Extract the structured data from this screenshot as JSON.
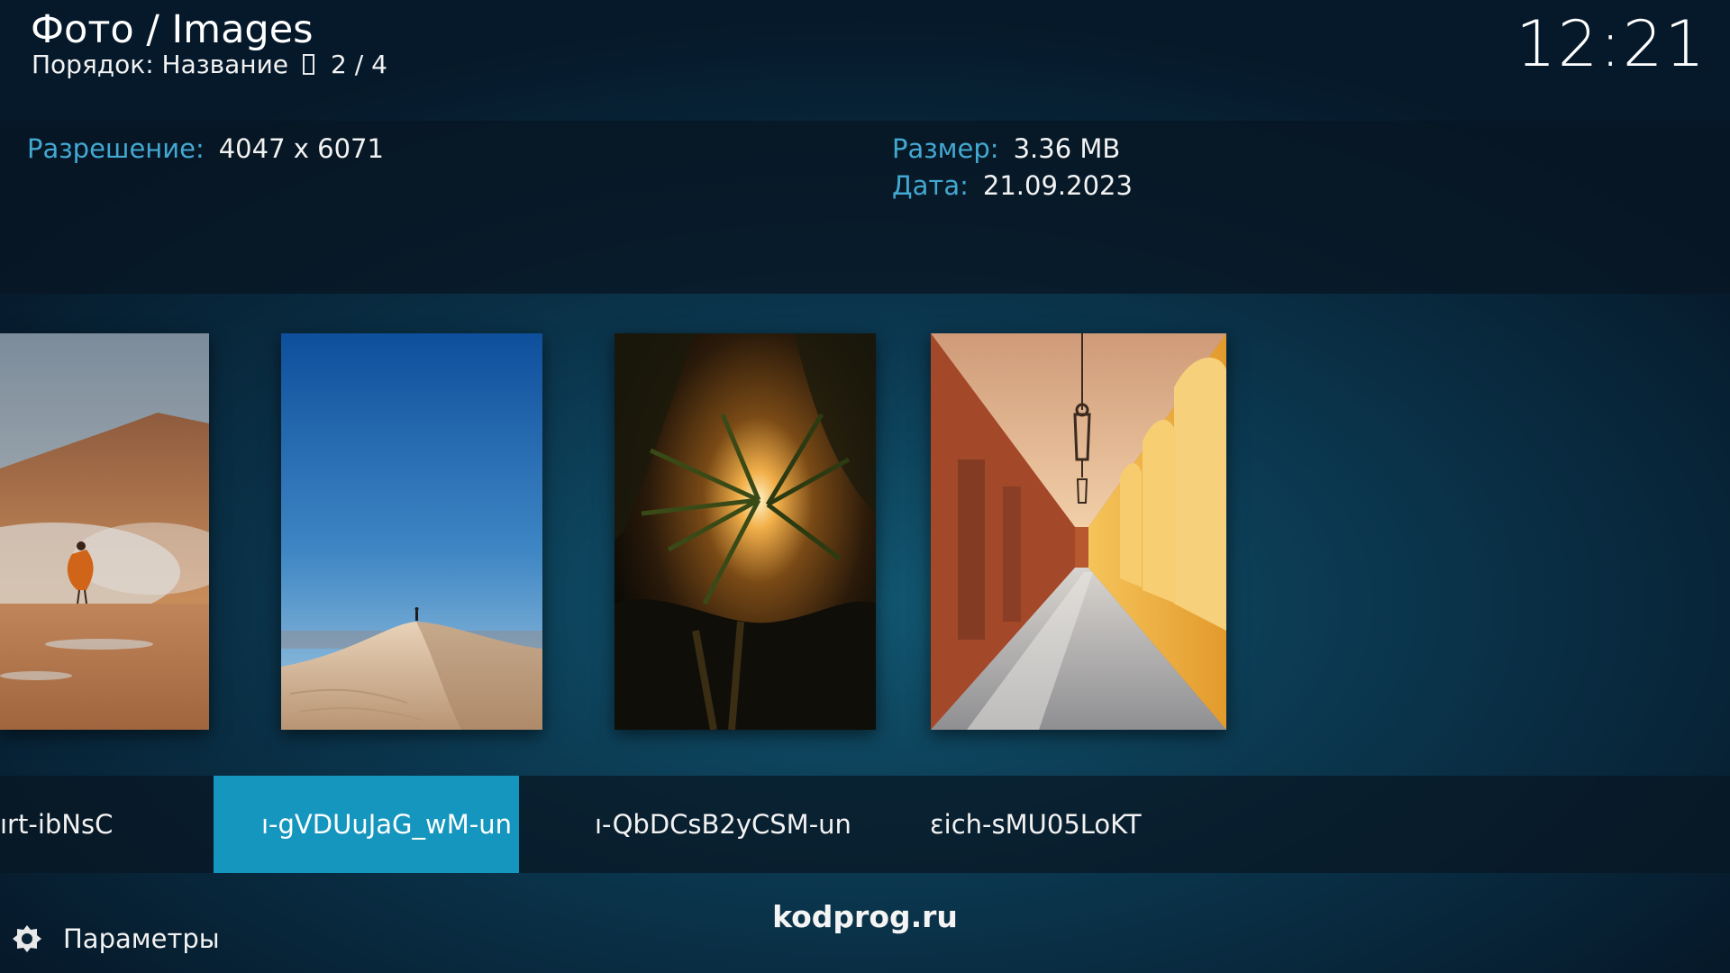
{
  "header": {
    "title": "Фото / Images",
    "sort_label": "Порядок: Название",
    "position": "2 / 4",
    "clock": "12:21"
  },
  "info": {
    "resolution_label": "Разрешение:",
    "resolution_value": "4047 x 6071",
    "size_label": "Размер:",
    "size_value": "3.36 MB",
    "date_label": "Дата:",
    "date_value": "21.09.2023"
  },
  "thumbnails": [
    {
      "name": "thumbnail-volcano-dancer"
    },
    {
      "name": "thumbnail-desert-dune"
    },
    {
      "name": "thumbnail-palm-sunlight"
    },
    {
      "name": "thumbnail-arched-corridor"
    }
  ],
  "labels": [
    {
      "text": "ırt-ibNsC",
      "focused": false
    },
    {
      "text": "ı-gVDUuJaG_wM-un",
      "focused": true
    },
    {
      "text": "ı-QbDCsB2yCSM-un",
      "focused": false
    },
    {
      "text": "ɛich-sMU05LoKT",
      "focused": false
    }
  ],
  "footer": {
    "settings_label": "Параметры",
    "settings_icon": "gear-icon",
    "watermark": "kodprog.ru"
  },
  "colors": {
    "accent": "#43a8d2",
    "focus": "#1596be"
  }
}
